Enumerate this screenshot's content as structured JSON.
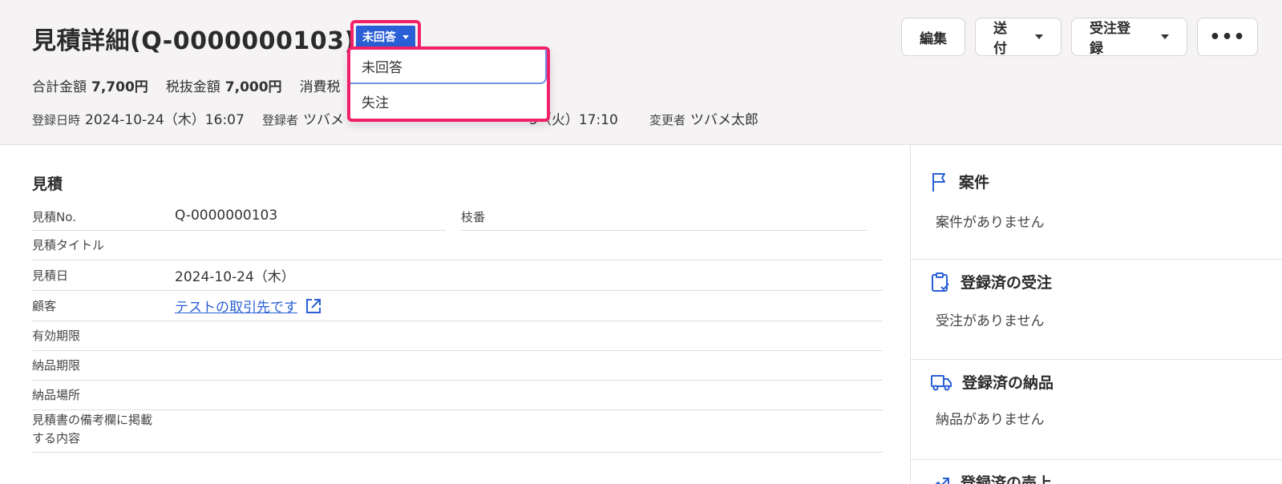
{
  "header": {
    "title": "見積詳細(Q-0000000103)",
    "status": "未回答",
    "summary": [
      {
        "label": "合計金額",
        "value": "7,700円"
      },
      {
        "label": "税抜金額",
        "value": "7,000円"
      },
      {
        "label": "消費税",
        "value": ""
      }
    ],
    "meta": {
      "created_label": "登録日時",
      "created_value": "2024-10-24（木）16:07",
      "creator_label": "登録者",
      "creator_value": "ツバメ",
      "updated_value": "5（火）17:10",
      "updater_label": "変更者",
      "updater_value": "ツバメ太郎"
    },
    "actions": {
      "edit": "編集",
      "send": "送付",
      "order": "受注登録",
      "more": "•••"
    }
  },
  "dropdown": {
    "options": [
      "未回答",
      "失注"
    ]
  },
  "estimate": {
    "section_title": "見積",
    "fields": {
      "no_label": "見積No.",
      "no_value": "Q-0000000103",
      "branch_label": "枝番",
      "title_label": "見積タイトル",
      "date_label": "見積日",
      "date_value": "2024-10-24（木）",
      "customer_label": "顧客",
      "customer_value": "テストの取引先です",
      "validity_label": "有効期限",
      "delivery_deadline_label": "納品期限",
      "delivery_place_label": "納品場所",
      "remarks_label_1": "見積書の備考欄に掲載",
      "remarks_label_2": "する内容"
    }
  },
  "side": {
    "project_title": "案件",
    "project_empty": "案件がありません",
    "orders_title": "登録済の受注",
    "orders_empty": "受注がありません",
    "deliveries_title": "登録済の納品",
    "deliveries_empty": "納品がありません",
    "sales_title": "登録済の売上"
  },
  "colors": {
    "accent": "#2a5fd6",
    "highlight": "#f0216a"
  }
}
